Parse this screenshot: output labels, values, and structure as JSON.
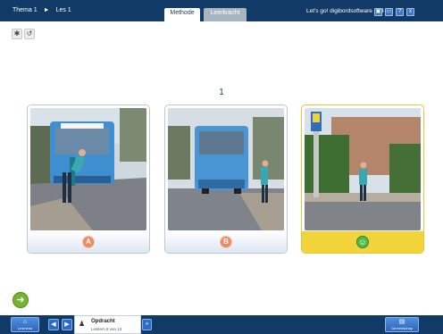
{
  "topbar": {
    "crumbs": [
      "Thema 1",
      "Les 1"
    ],
    "tabs": [
      "Methode",
      "Leerkracht"
    ],
    "app_title": "Let's go! digibordsoftware gr 4",
    "icons": [
      "display-icon",
      "window-icon",
      "help-icon",
      "close-icon"
    ],
    "icon_glyphs": [
      "▣",
      "▭",
      "?",
      "x"
    ]
  },
  "tools": {
    "settings_glyph": "✱",
    "reset_glyph": "↺"
  },
  "page_number": "1",
  "cards": [
    {
      "label": "A",
      "state": "default"
    },
    {
      "label": "B",
      "state": "default"
    },
    {
      "label": "☺",
      "state": "correct"
    }
  ],
  "next_button": {
    "glyph": "➜"
  },
  "bottombar": {
    "home_label": "Lesmenu",
    "prev_glyph": "◀",
    "next_glyph": "▶",
    "assignment_title": "Opdracht",
    "assignment_progress": "Lesitem 8 van 13",
    "expand_glyph": "»",
    "tools_label": "Gereedschap"
  },
  "colors": {
    "bar": "#123a66",
    "selected": "#f3d33a",
    "orange": "#ec8b63",
    "green": "#52b848"
  }
}
